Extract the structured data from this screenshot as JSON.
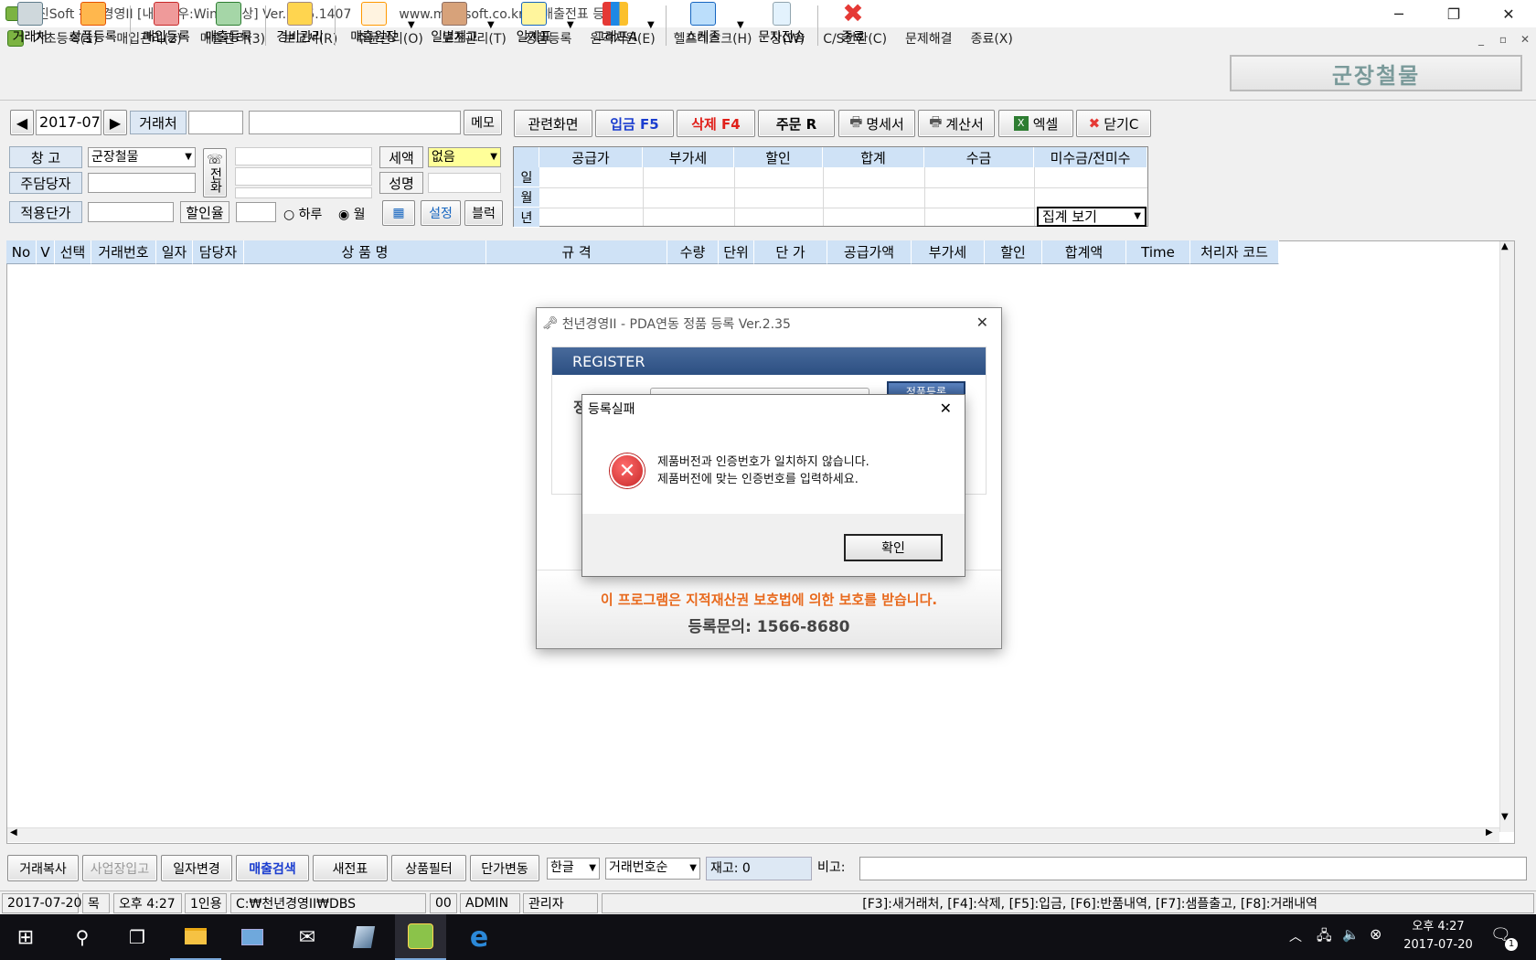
{
  "titlebar": {
    "title": "미진Soft 천년경영II [내윈도우:Win 7이상] Ver.2.35.1407",
    "url": "www.mijinsoft.co.kr - [매출전표 등록]"
  },
  "menu": [
    "기초등록(1)",
    "매입관리(2)",
    "매출관리(3)",
    "보고서(R)",
    "주문관리(O)",
    "보조관리(T)",
    "정품등록",
    "원격지원(E)",
    "헬프데스크(H)",
    "창(W)",
    "C/S전환(C)",
    "문제해결",
    "종료(X)"
  ],
  "toolbar": [
    "거래처",
    "상품등록",
    "매입등록",
    "매출등록",
    "경비관리",
    "매출원장",
    "일별재고",
    "일계표",
    "그래프A",
    "스케줄",
    "문자전송",
    "종료"
  ],
  "brand": "군장철물",
  "nav": {
    "month": "2017-07",
    "customer_label": "거래처",
    "memo": "메모"
  },
  "actions": [
    "관련화면",
    "입금 F5",
    "삭제 F4",
    "주문 R",
    "명세서",
    "계산서",
    "엑셀",
    "닫기C"
  ],
  "form": {
    "warehouse_label": "창    고",
    "warehouse_value": "군장철물",
    "manager_label": "주담당자",
    "price_label": "적용단가",
    "discount_label": "할인율",
    "phone_label": "전화",
    "tax_label": "세액",
    "tax_value": "없음",
    "name_label": "성명",
    "radio_day": "하루",
    "radio_month": "월",
    "setting": "설정",
    "block": "블럭"
  },
  "summary": {
    "headers": [
      "공급가",
      "부가세",
      "할인",
      "합계",
      "수금",
      "미수금/전미수"
    ],
    "rows": [
      "일",
      "월",
      "년"
    ],
    "select": "집계 보기"
  },
  "grid_headers": [
    "No",
    "V",
    "선택",
    "거래번호",
    "일자",
    "담당자",
    "상 품 명",
    "규 격",
    "수량",
    "단위",
    "단 가",
    "공급가액",
    "부가세",
    "할인",
    "합계액",
    "Time",
    "처리자 코드"
  ],
  "bottom": {
    "buttons": [
      "거래복사",
      "사업장입고",
      "일자변경",
      "매출검색",
      "새전표",
      "상품필터",
      "단가변동"
    ],
    "lang": "한글",
    "sort": "거래번호순",
    "stock": "재고: 0",
    "note_label": "비고:"
  },
  "status": {
    "date": "2017-07-20",
    "day": "목",
    "time": "오후 4:27",
    "users": "1인용",
    "path": "C:₩천년경영II₩DBS",
    "code": "00",
    "user": "ADMIN",
    "role": "관리자",
    "hint": "[F3]:새거래처, [F4]:삭제, [F5]:입금, [F6]:반품내역, [F7]:샘플출고, [F8]:거래내역"
  },
  "reg_dialog": {
    "title": "천년경영II - PDA연동 정품 등록 Ver.2.35",
    "header": "REGISTER",
    "button": "정품등록",
    "notice": "이 프로그램은 지적재산권 보호법에 의한 보호를 받습니다.",
    "contact": "등록문의: 1566-8680"
  },
  "error_dialog": {
    "title": "등록실패",
    "line1": "제품버전과 인증번호가 일치하지 않습니다.",
    "line2": "제품버전에 맞는 인증번호를 입력하세요.",
    "ok": "확인"
  },
  "taskbar": {
    "time": "오후 4:27",
    "date": "2017-07-20",
    "notif": "1"
  }
}
